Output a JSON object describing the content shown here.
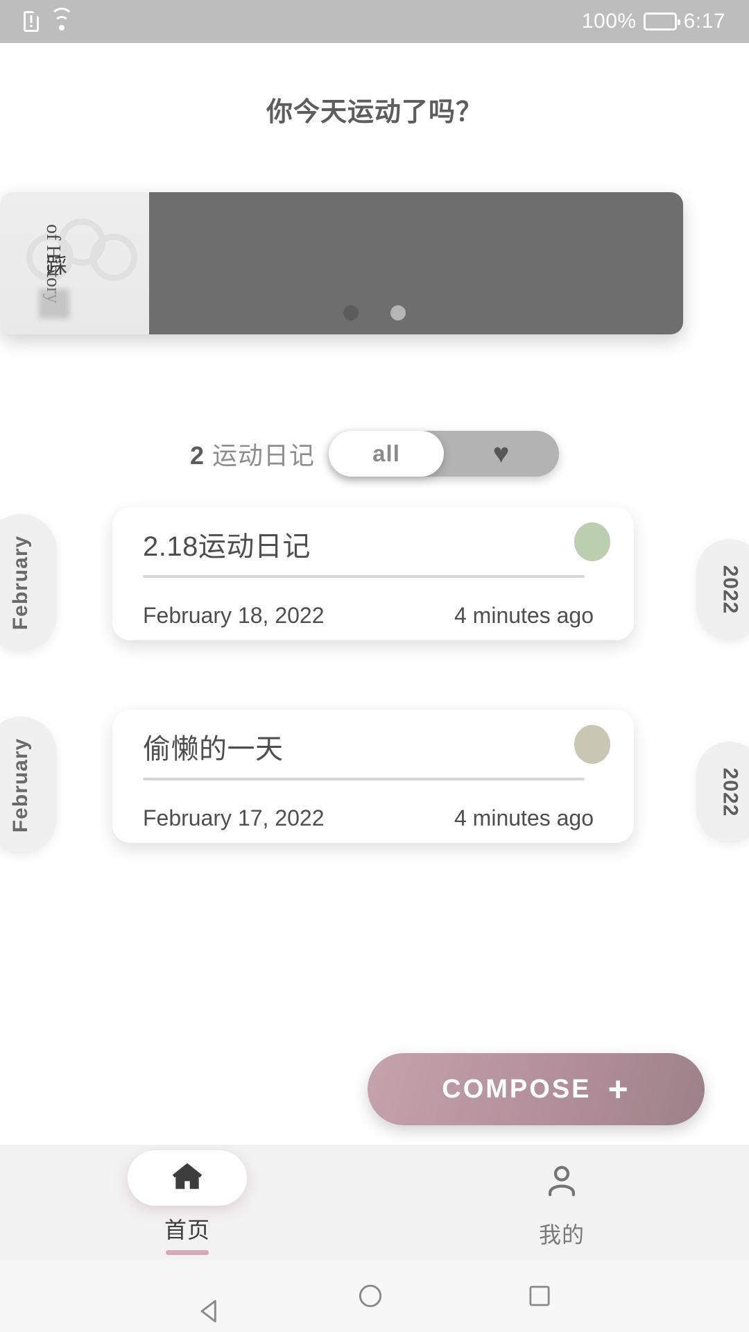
{
  "status_bar": {
    "sim_icon": "sim-alert-icon",
    "wifi_icon": "wifi-icon",
    "battery_percent": "100%",
    "battery_icon": "battery-full-icon",
    "time": "6:17"
  },
  "header": {
    "title": "你今天运动了吗？"
  },
  "carousel": {
    "thumb_latin_text": "of History",
    "thumb_cn_text": "踩",
    "dots": [
      {
        "state": "active"
      },
      {
        "state": "inactive"
      }
    ]
  },
  "list_header": {
    "count": "2",
    "count_suffix": "运动日记",
    "filter": {
      "selected": "all",
      "options": [
        {
          "label": "all",
          "icon": "",
          "selected": true
        },
        {
          "label": "",
          "icon": "heart-icon",
          "selected": false
        }
      ],
      "heart_glyph": "♥"
    }
  },
  "entries": [
    {
      "month": "February",
      "year": "2022",
      "title": "2.18运动日记",
      "date": "February 18, 2022",
      "relative_time": "4 minutes ago",
      "mood_color": "#bcceb0"
    },
    {
      "month": "February",
      "year": "2022",
      "title": "偷懒的一天",
      "date": "February 17, 2022",
      "relative_time": "4 minutes ago",
      "mood_color": "#c9c6b3"
    }
  ],
  "compose": {
    "label": "COMPOSE",
    "plus_glyph": "+",
    "accent_color": "#a98e98"
  },
  "tabbar": {
    "tabs": [
      {
        "label": "首页",
        "icon": "home-icon",
        "active": true
      },
      {
        "label": "我的",
        "icon": "person-icon",
        "active": false
      }
    ],
    "indicator_color": "#d6a8b4"
  },
  "navbar": {
    "back_icon": "triangle-back-icon",
    "home_icon": "circle-home-icon",
    "recent_icon": "square-recents-icon"
  }
}
